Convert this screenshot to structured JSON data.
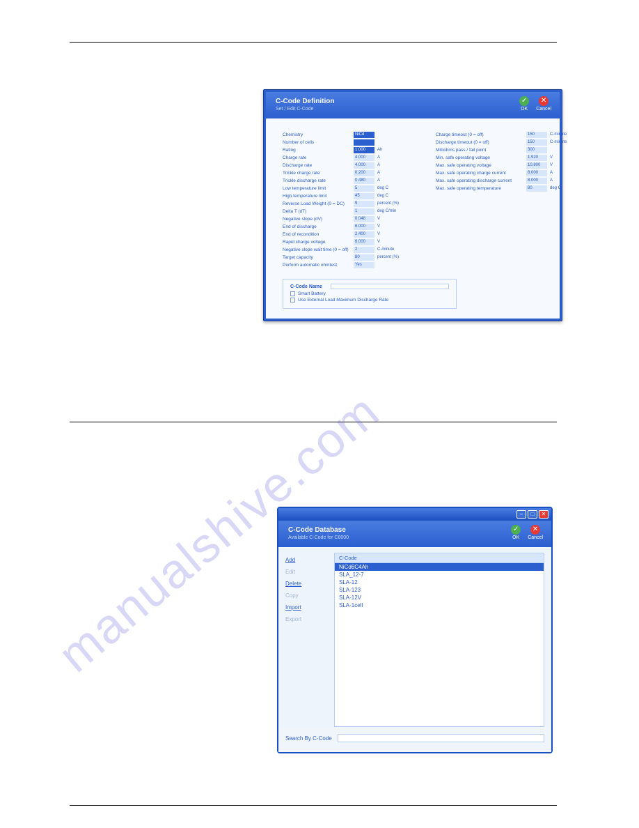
{
  "watermark": "manualshive.com",
  "dialog1": {
    "title": "C-Code Definition",
    "subtitle": "Set / Edit C-Code",
    "ok_label": "OK",
    "cancel_label": "Cancel",
    "left_params": [
      {
        "label": "Chemistry",
        "value": "NiCd",
        "unit": "",
        "selected": true
      },
      {
        "label": "Number of cells",
        "value": "",
        "unit": "",
        "selected": true
      },
      {
        "label": "Rating",
        "value": "1.000",
        "unit": "Ah",
        "selected": true
      },
      {
        "label": "Charge rate",
        "value": "4.000",
        "unit": "A"
      },
      {
        "label": "Discharge rate",
        "value": "4.000",
        "unit": "A"
      },
      {
        "label": "Trickle charge rate",
        "value": "0.200",
        "unit": "A"
      },
      {
        "label": "Trickle discharge rate",
        "value": "0.480",
        "unit": "A"
      },
      {
        "label": "Low temperature limit",
        "value": "5",
        "unit": "deg C"
      },
      {
        "label": "High temperature limit",
        "value": "45",
        "unit": "deg C"
      },
      {
        "label": "Reverse Load Weight (0 = DC)",
        "value": "9",
        "unit": "percent (%)"
      },
      {
        "label": "Delta T (dT)",
        "value": "1",
        "unit": "deg C/min"
      },
      {
        "label": "Negative slope (dV)",
        "value": "0.048",
        "unit": "V"
      },
      {
        "label": "End of discharge",
        "value": "6.000",
        "unit": "V"
      },
      {
        "label": "End of recondition",
        "value": "2.400",
        "unit": "V"
      },
      {
        "label": "Rapid charge voltage",
        "value": "6.000",
        "unit": "V"
      },
      {
        "label": "Negative slope wait time (0 = off)",
        "value": "2",
        "unit": "C-minute"
      },
      {
        "label": "Target capacity",
        "value": "80",
        "unit": "percent (%)"
      },
      {
        "label": "Perform automatic ohmtest",
        "value": "Yes",
        "unit": ""
      }
    ],
    "right_params": [
      {
        "label": "Charge timeout (0 = off)",
        "value": "150",
        "unit": "C-minute"
      },
      {
        "label": "Discharge timeout (0 = off)",
        "value": "150",
        "unit": "C-minute"
      },
      {
        "label": "Milliohms pass / fail point",
        "value": "300",
        "unit": ""
      },
      {
        "label": "Min. safe operating voltage",
        "value": "1.920",
        "unit": "V"
      },
      {
        "label": "Max. safe operating voltage",
        "value": "10.800",
        "unit": "V"
      },
      {
        "label": "Max. safe operating charge current",
        "value": "8.000",
        "unit": "A"
      },
      {
        "label": "Max. safe operating discharge current",
        "value": "8.000",
        "unit": "A"
      },
      {
        "label": "Max. safe operating temperature",
        "value": "80",
        "unit": "deg C"
      }
    ],
    "name_box": {
      "title": "C-Code Name",
      "smart_battery": "Smart Battery",
      "use_external": "Use External Load Maximum Discharge Rate"
    }
  },
  "dialog2": {
    "title": "C-Code Database",
    "subtitle": "Available C-Code for C8000",
    "ok_label": "OK",
    "cancel_label": "Cancel",
    "sidebar": {
      "add": "Add",
      "edit": "Edit",
      "delete": "Delete",
      "copy": "Copy",
      "import": "Import",
      "export": "Export"
    },
    "list_header": "C-Code",
    "rows": [
      {
        "text": "NiCd6C4Ah",
        "selected": true
      },
      {
        "text": "SLA_12-7"
      },
      {
        "text": "SLA-12"
      },
      {
        "text": "SLA-123"
      },
      {
        "text": "SLA-12V"
      },
      {
        "text": "SLA-1cell"
      }
    ],
    "search_label": "Search By C-Code"
  }
}
